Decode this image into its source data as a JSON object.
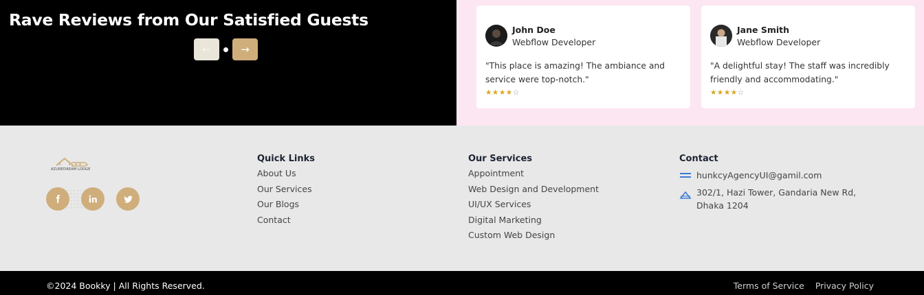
{
  "reviews": {
    "title": "Rave Reviews from Our Satisfied Guests",
    "prev_icon": "arrow-left-icon",
    "prev_label": "←",
    "next_icon": "arrow-right-icon",
    "next_label": "→",
    "items": [
      {
        "name": "John Doe",
        "role": "Webflow Developer",
        "text": "\"This place is amazing! The ambiance and service were top-notch.\"",
        "rating": 4,
        "max_rating": 5
      },
      {
        "name": "Jane Smith",
        "role": "Webflow Developer",
        "text": "\"A delightful stay! The staff was incredibly friendly and accommodating.\"",
        "rating": 4,
        "max_rating": 5
      }
    ]
  },
  "footer": {
    "logo_text": "AZUREDREAM LODGE",
    "social": [
      "facebook-icon",
      "linkedin-icon",
      "twitter-icon"
    ],
    "quick_links": {
      "title": "Quick Links",
      "items": [
        "About Us",
        "Our Services",
        "Our Blogs",
        "Contact"
      ]
    },
    "services": {
      "title": "Our Services",
      "items": [
        "Appointment",
        "Web Design and Development",
        "UI/UX Services",
        "Digital Marketing",
        "Custom Web Design"
      ]
    },
    "contact": {
      "title": "Contact",
      "email": "hunkcyAgencyUI@gamil.com",
      "address": "302/1, Hazi Tower, Gandaria New Rd, Dhaka 1204"
    }
  },
  "bottom": {
    "copyright": "©2024 Bookky | All Rights Reserved.",
    "terms": "Terms of Service",
    "privacy": "Privacy Policy"
  },
  "colors": {
    "accent": "#cfae7c",
    "reviews_bg": "#fce6f1",
    "footer_bg": "#e8e8e8",
    "star": "#d9a520"
  }
}
